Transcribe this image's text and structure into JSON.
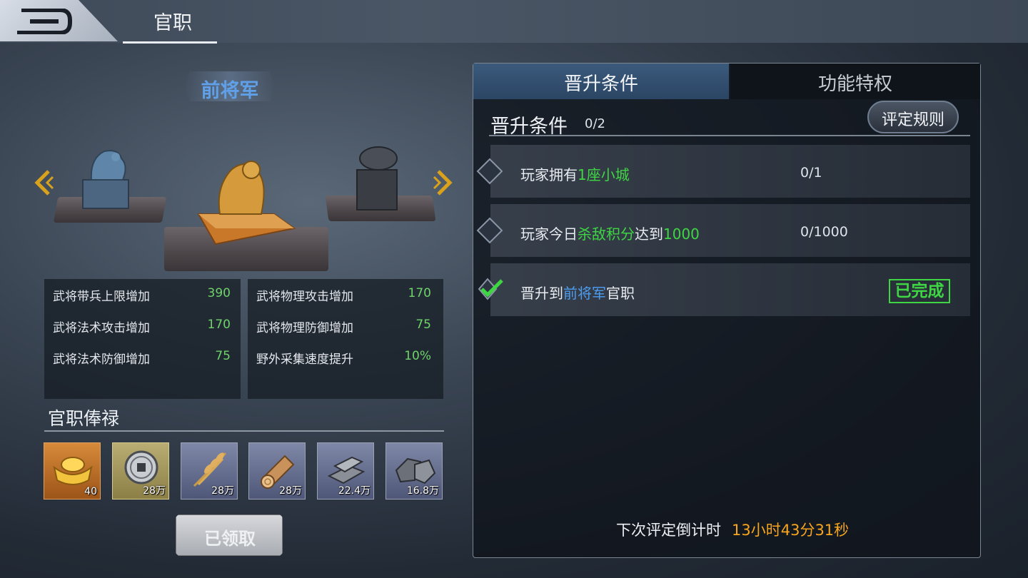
{
  "header": {
    "title": "官职"
  },
  "rank": {
    "name": "前将军"
  },
  "stats_left": [
    {
      "label": "武将带兵上限增加",
      "value": "390"
    },
    {
      "label": "武将法术攻击增加",
      "value": "170"
    },
    {
      "label": "武将法术防御增加",
      "value": "75"
    }
  ],
  "stats_right": [
    {
      "label": "武将物理攻击增加",
      "value": "170"
    },
    {
      "label": "武将物理防御增加",
      "value": "75"
    },
    {
      "label": "野外采集速度提升",
      "value": "10%"
    }
  ],
  "salary": {
    "title": "官职俸禄",
    "items": [
      {
        "icon": "gold-ingot-icon",
        "qty": "40"
      },
      {
        "icon": "copper-coin-icon",
        "qty": "28万"
      },
      {
        "icon": "grain-icon",
        "qty": "28万"
      },
      {
        "icon": "wood-log-icon",
        "qty": "28万"
      },
      {
        "icon": "iron-ingot-icon",
        "qty": "22.4万"
      },
      {
        "icon": "stone-icon",
        "qty": "16.8万"
      }
    ],
    "claim_label": "已领取"
  },
  "tabs": {
    "promote": "晋升条件",
    "privilege": "功能特权"
  },
  "conditions": {
    "title": "晋升条件",
    "count": "0/2",
    "rules_label": "评定规则",
    "rows": [
      {
        "p1": "玩家拥有",
        "h1": "1座",
        "h2": "小城",
        "progress": "0/1"
      },
      {
        "p1": "玩家今日",
        "h1": "杀敌积分",
        "p2": "达到",
        "h2": "1000",
        "progress": "0/1000"
      },
      {
        "p1": "晋升到",
        "h1": "前将军",
        "p2": "官职",
        "status": "已完成"
      }
    ]
  },
  "timer": {
    "label": "下次评定倒计时",
    "value": "13小时43分31秒"
  },
  "colors": {
    "accent_green": "#3fd644",
    "accent_blue": "#4d9df0",
    "accent_orange": "#f7a51d"
  }
}
